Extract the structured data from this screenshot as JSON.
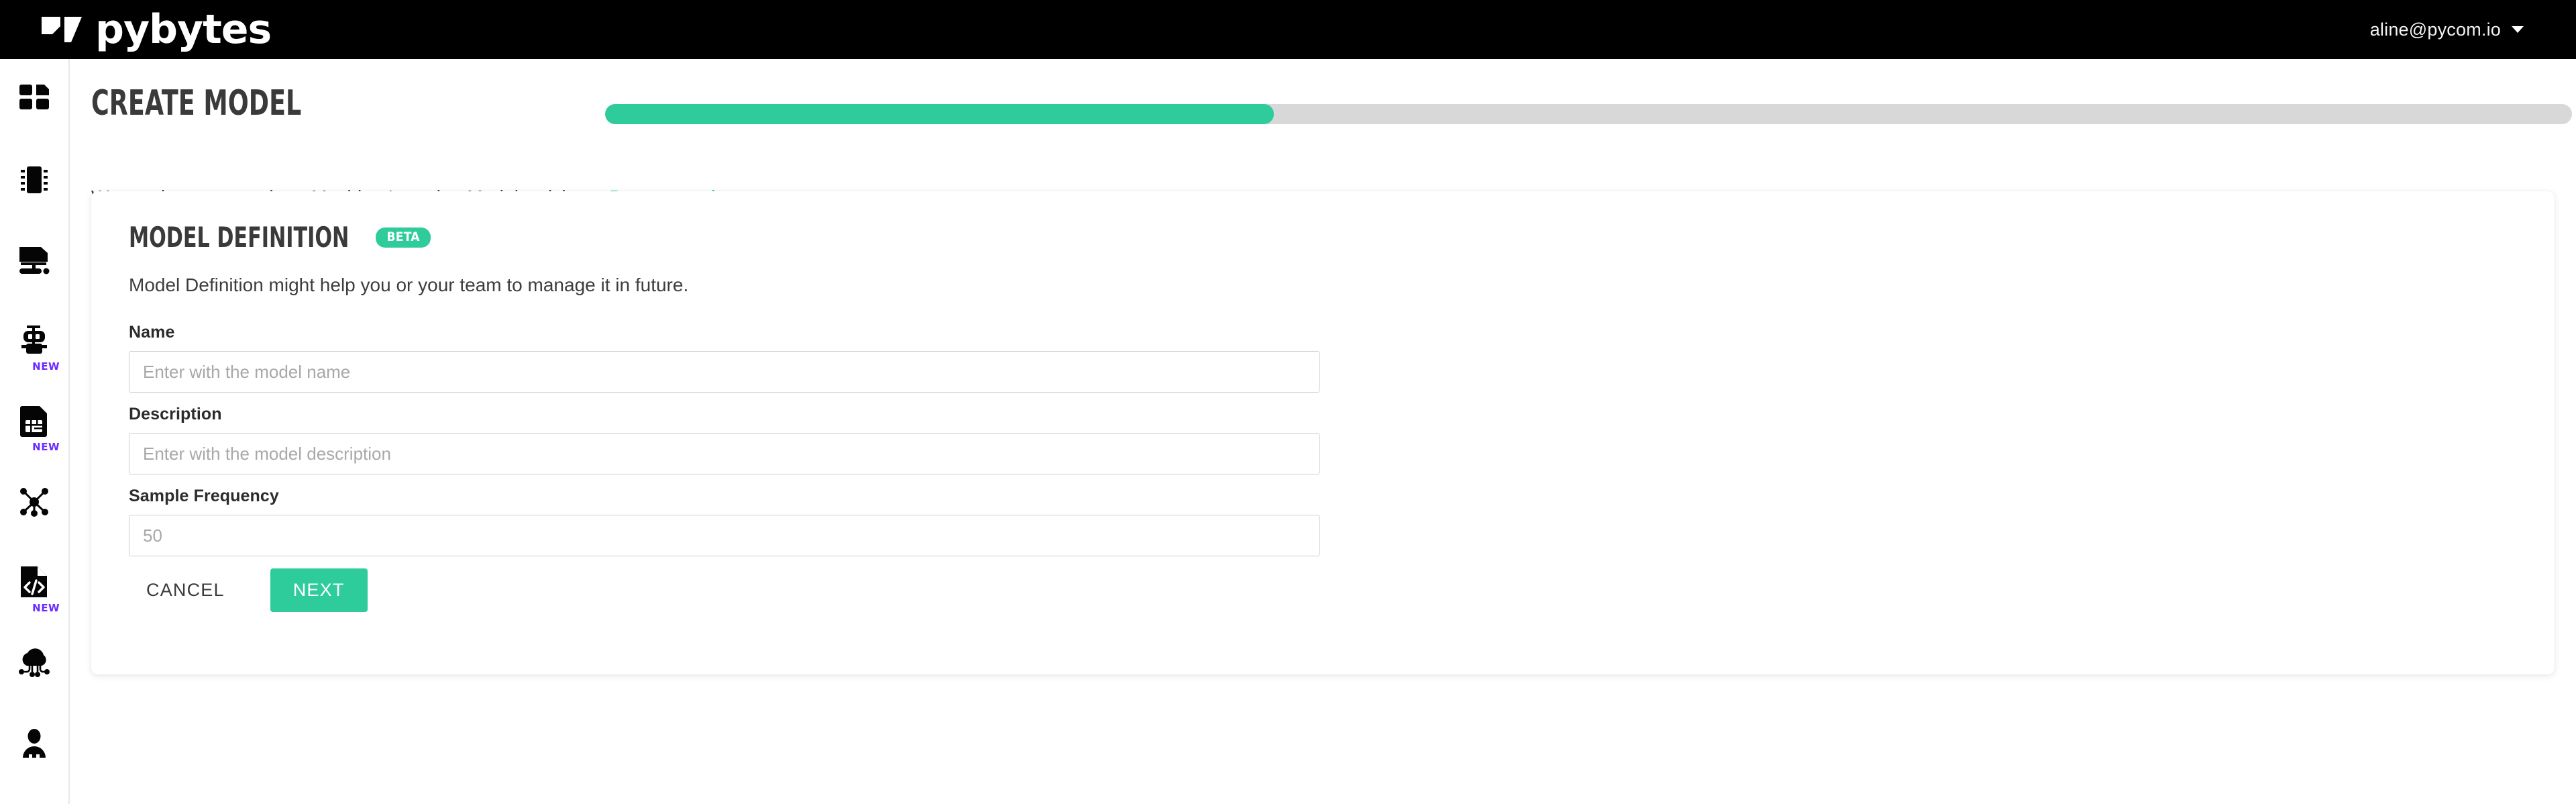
{
  "brand": {
    "name": "pybytes",
    "logo_icon": "pybytes-flag-logo"
  },
  "topbar": {
    "account_email": "aline@pycom.io",
    "caret_icon": "chevron-down-icon"
  },
  "sidebar": {
    "items": [
      {
        "icon": "dashboard-grid-icon",
        "name": "sidebar-item-dashboard",
        "badge": ""
      },
      {
        "icon": "chip-icon",
        "name": "sidebar-item-devices",
        "badge": ""
      },
      {
        "icon": "desktop-monitor-icon",
        "name": "sidebar-item-terminal",
        "badge": ""
      },
      {
        "icon": "robot-icon",
        "name": "sidebar-item-ml",
        "badge": "NEW"
      },
      {
        "icon": "sim-card-icon",
        "name": "sidebar-item-sim",
        "badge": "NEW"
      },
      {
        "icon": "network-nodes-icon",
        "name": "sidebar-item-network",
        "badge": ""
      },
      {
        "icon": "code-file-icon",
        "name": "sidebar-item-firmware",
        "badge": "NEW"
      },
      {
        "icon": "cloud-iot-icon",
        "name": "sidebar-item-cloud",
        "badge": ""
      },
      {
        "icon": "user-profile-icon",
        "name": "sidebar-item-account",
        "badge": ""
      }
    ]
  },
  "page": {
    "title": "CREATE MODEL",
    "progress_percent": 34,
    "subtitle_prefix": "Want to know more about Machine Learning Models, visit our ",
    "subtitle_link": "Documentation",
    "subtitle_suffix": "."
  },
  "card": {
    "title": "MODEL DEFINITION",
    "badge": "BETA",
    "description": "Model Definition might help you or your team to manage it in future.",
    "fields": [
      {
        "label": "Name",
        "value": "",
        "placeholder": "Enter with the model name"
      },
      {
        "label": "Description",
        "value": "",
        "placeholder": "Enter with the model description"
      },
      {
        "label": "Sample Frequency",
        "value": "",
        "placeholder": "50"
      }
    ],
    "cancel_label": "CANCEL",
    "next_label": "NEXT"
  },
  "colors": {
    "accent_green": "#2ecb9b",
    "badge_purple": "#6c2bff",
    "track_gray": "#d8d8d8",
    "topbar_black": "#000000"
  }
}
